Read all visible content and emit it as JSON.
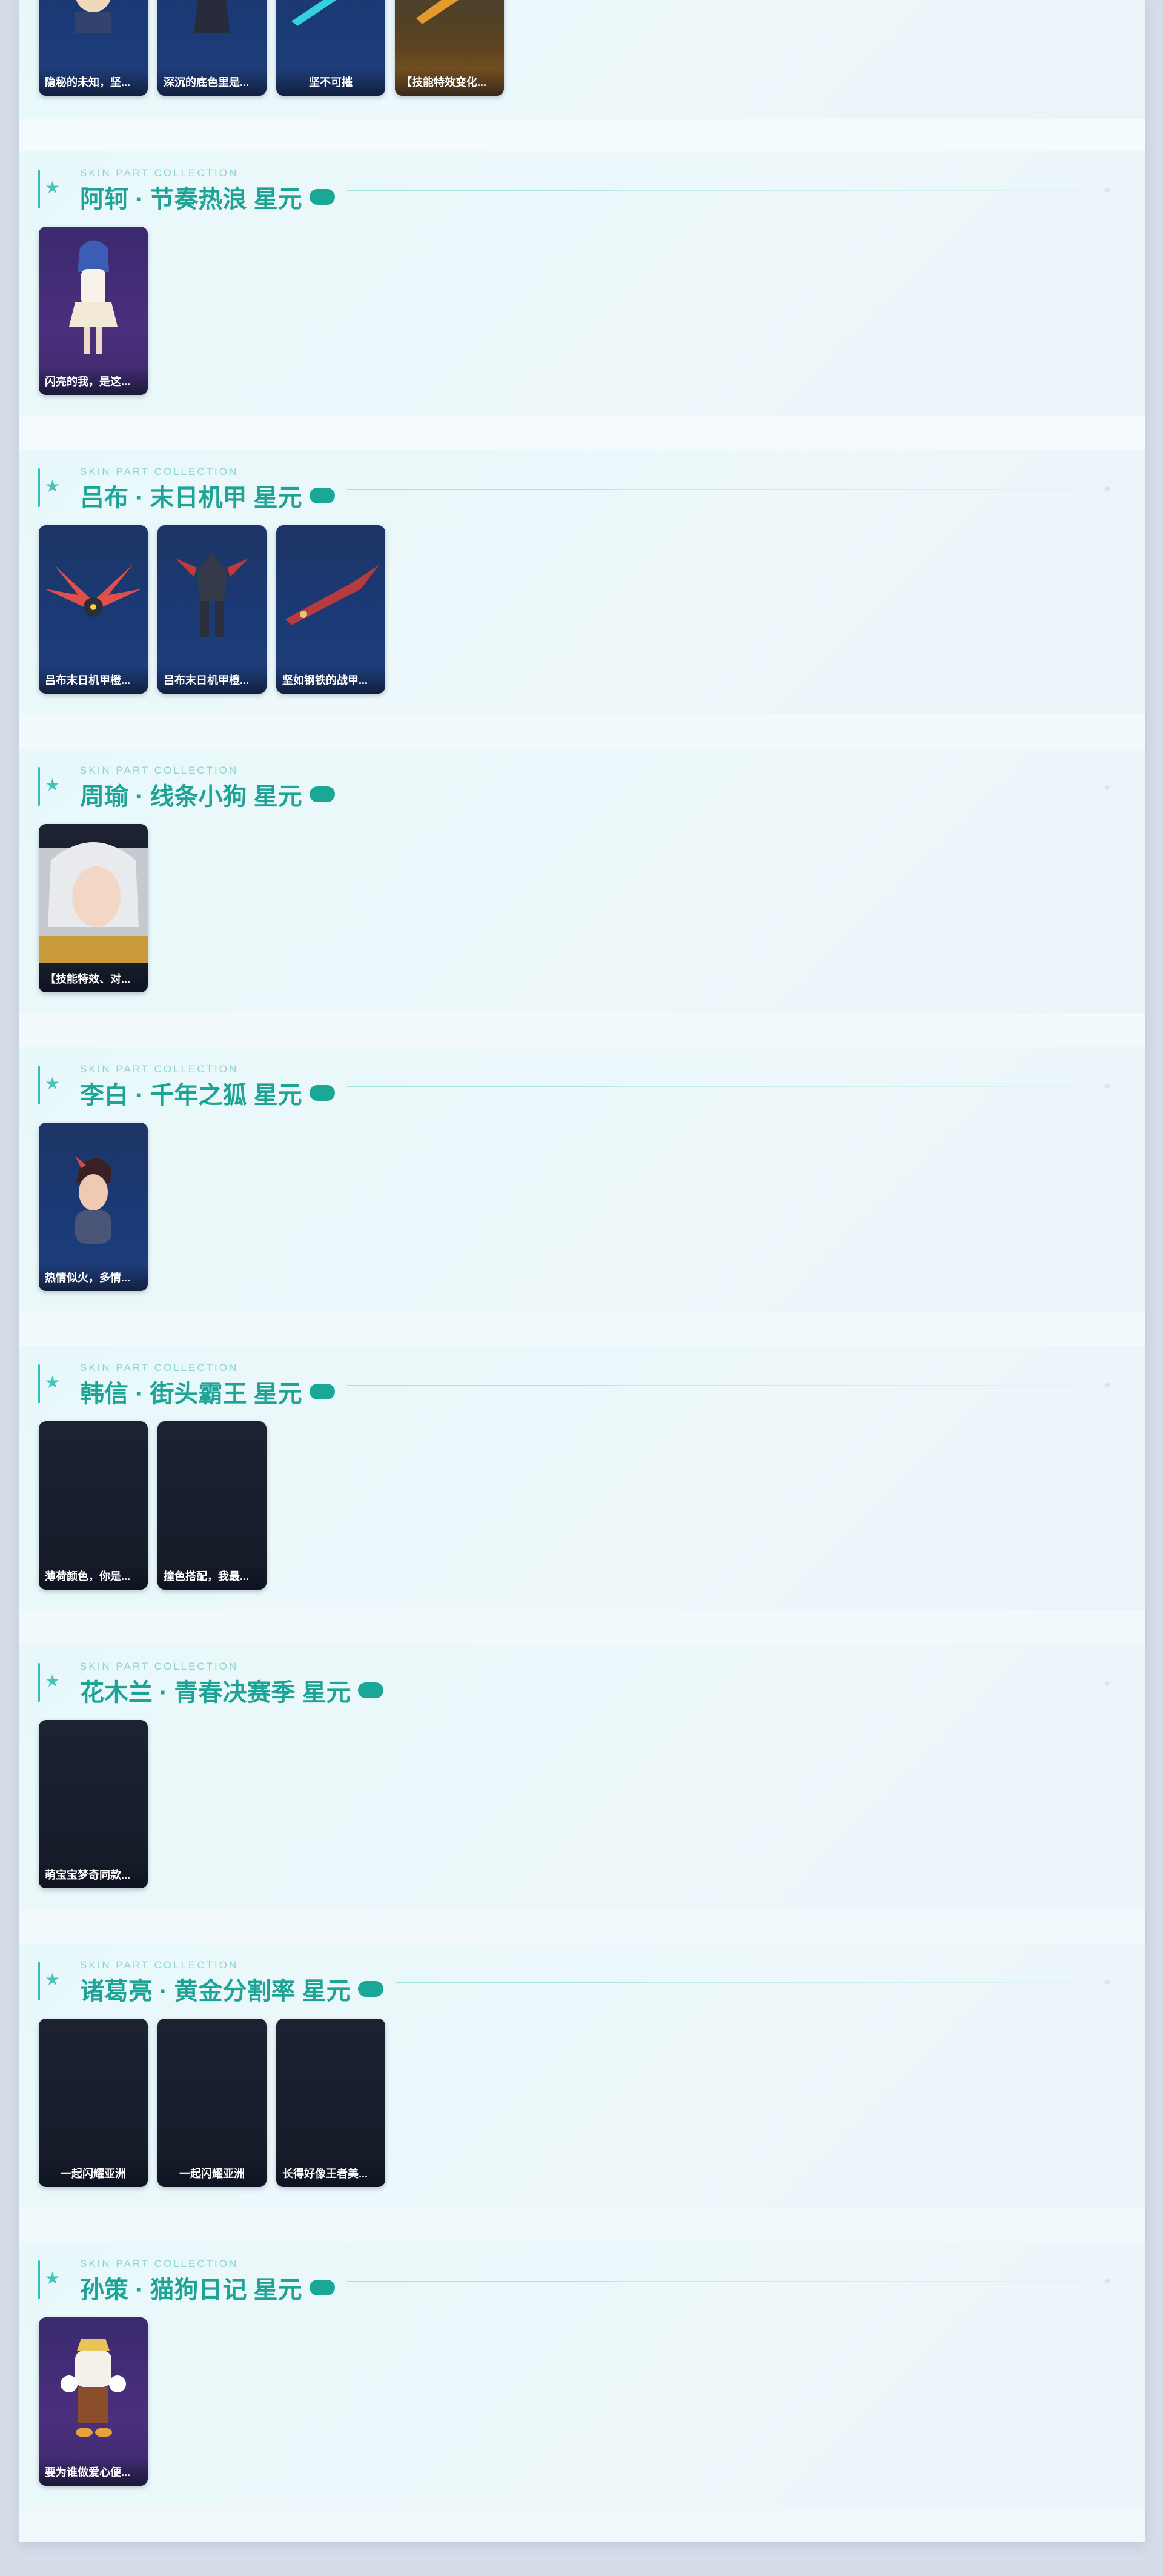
{
  "top_cards": [
    {
      "label": "隐秘的未知，坚...",
      "bg": "blue"
    },
    {
      "label": "深沉的底色里是...",
      "bg": "blue"
    },
    {
      "label": "坚不可摧",
      "bg": "blue",
      "center": true
    },
    {
      "label": "【技能特效变化...",
      "bg": "orange"
    }
  ],
  "sections": [
    {
      "sub": "SKIN PART COLLECTION",
      "title": "阿轲 · 节奏热浪 星元",
      "cards": [
        {
          "label": "闪亮的我，是这...",
          "bg": "purple",
          "art": "girl"
        }
      ]
    },
    {
      "sub": "SKIN PART COLLECTION",
      "title": "吕布 · 末日机甲 星元",
      "cards": [
        {
          "label": "吕布末日机甲橙...",
          "bg": "blue",
          "art": "wings"
        },
        {
          "label": "吕布末日机甲橙...",
          "bg": "blue",
          "art": "mech"
        },
        {
          "label": "坚如钢铁的战甲...",
          "bg": "blue",
          "art": "blade"
        }
      ]
    },
    {
      "sub": "SKIN PART COLLECTION",
      "title": "周瑜 · 线条小狗 星元",
      "cards": [
        {
          "label": "【技能特效、对...",
          "bg": "dark",
          "art": "portrait"
        }
      ]
    },
    {
      "sub": "SKIN PART COLLECTION",
      "title": "李白 · 千年之狐 星元",
      "cards": [
        {
          "label": "热情似火，多情...",
          "bg": "blue",
          "art": "head"
        }
      ]
    },
    {
      "sub": "SKIN PART COLLECTION",
      "title": "韩信 · 街头霸王 星元",
      "cards": [
        {
          "label": "薄荷颜色，你是...",
          "bg": "dark"
        },
        {
          "label": "撞色搭配，我最...",
          "bg": "dark"
        }
      ]
    },
    {
      "sub": "SKIN PART COLLECTION",
      "title": "花木兰 · 青春决赛季 星元",
      "cards": [
        {
          "label": "萌宝宝梦奇同款...",
          "bg": "dark"
        }
      ]
    },
    {
      "sub": "SKIN PART COLLECTION",
      "title": "诸葛亮 · 黄金分割率 星元",
      "cards": [
        {
          "label": "一起闪耀亚洲",
          "bg": "dark",
          "center": true
        },
        {
          "label": "一起闪耀亚洲",
          "bg": "dark",
          "center": true
        },
        {
          "label": "长得好像王者美...",
          "bg": "dark"
        }
      ]
    },
    {
      "sub": "SKIN PART COLLECTION",
      "title": "孙策 · 猫狗日记 星元",
      "cards": [
        {
          "label": "要为谁做爱心便...",
          "bg": "purple",
          "art": "outfit"
        }
      ]
    }
  ]
}
